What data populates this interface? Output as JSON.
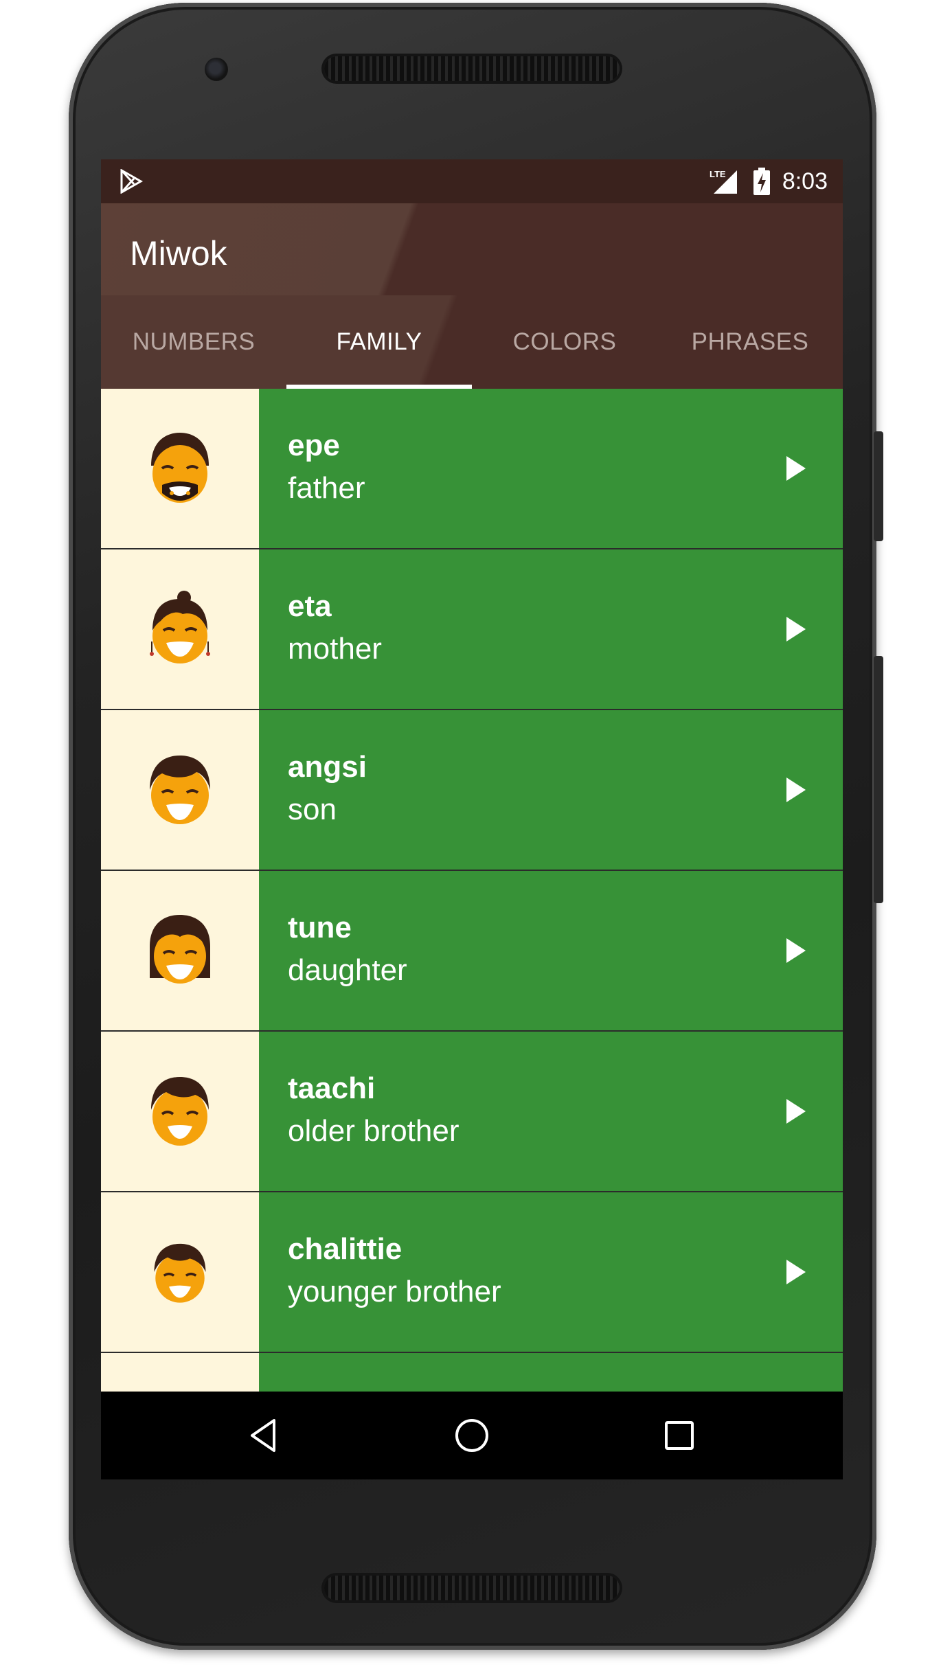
{
  "status_bar": {
    "network": "LTE",
    "time": "8:03"
  },
  "app": {
    "title": "Miwok"
  },
  "tabs": [
    {
      "label": "NUMBERS",
      "active": false
    },
    {
      "label": "FAMILY",
      "active": true
    },
    {
      "label": "COLORS",
      "active": false
    },
    {
      "label": "PHRASES",
      "active": false
    }
  ],
  "list": {
    "items": [
      {
        "miwok": "epe",
        "english": "father",
        "icon": "father-face-icon"
      },
      {
        "miwok": "eta",
        "english": "mother",
        "icon": "mother-face-icon"
      },
      {
        "miwok": "angsi",
        "english": "son",
        "icon": "son-face-icon"
      },
      {
        "miwok": "tune",
        "english": "daughter",
        "icon": "daughter-face-icon"
      },
      {
        "miwok": "taachi",
        "english": "older brother",
        "icon": "older-brother-face-icon"
      },
      {
        "miwok": "chalittie",
        "english": "younger brother",
        "icon": "younger-brother-face-icon"
      }
    ]
  },
  "colors": {
    "app_bar": "#5d4037",
    "list_background": "#379237",
    "avatar_background": "#fef6dc",
    "face": "#f5a20c",
    "hair": "#3a1f14"
  }
}
